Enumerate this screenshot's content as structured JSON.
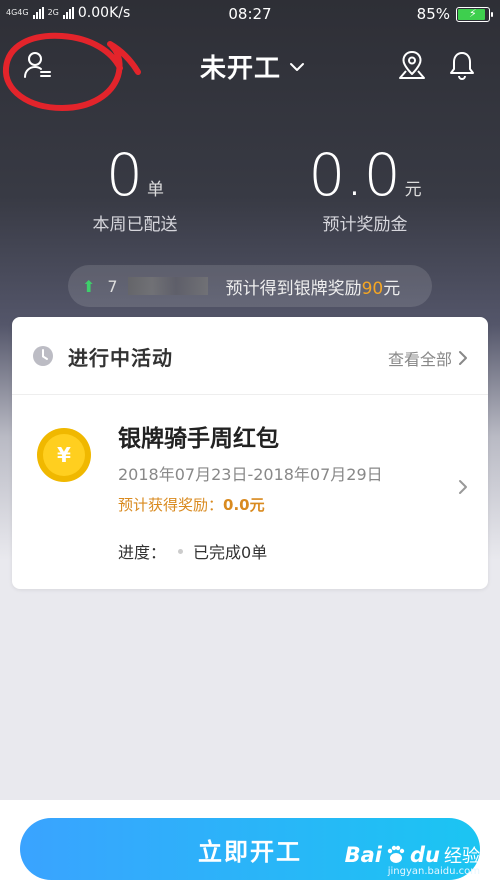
{
  "status": {
    "network_labels": [
      "4G",
      "4G",
      "2G"
    ],
    "speed": "0.00K/s",
    "time": "08:27",
    "battery": "85%",
    "battery_level": 0.85
  },
  "header": {
    "title": "未开工",
    "icons": [
      "user-menu-icon",
      "location-icon",
      "bell-icon"
    ]
  },
  "stats": {
    "deliveries": {
      "value": "0",
      "unit": "单",
      "label": "本周已配送"
    },
    "reward": {
      "value": "0.0",
      "unit": "元",
      "label": "预计奖励金"
    }
  },
  "banner": {
    "rank_glyph": "7",
    "text": "预计得到银牌奖励",
    "amount": "90",
    "unit": "元"
  },
  "activities": {
    "title": "进行中活动",
    "see_all": "查看全部",
    "item": {
      "name": "银牌骑手周红包",
      "date": "2018年07月23日-2018年07月29日",
      "reward_label": "预计获得奖励：",
      "reward_value": "0.0元",
      "progress_label": "进度：",
      "progress_value": "已完成0单",
      "coin_symbol": "¥"
    }
  },
  "action": {
    "start_label": "立即开工"
  },
  "watermark": {
    "brand": "Bai",
    "brand2": "du",
    "cn": "经验",
    "site": "jingyan.baidu.com"
  },
  "colors": {
    "accent_orange": "#f5a623",
    "reward_orange": "#d98a1f",
    "button_start": "#3aa3ff",
    "button_end": "#1bc5f2",
    "annotation_red": "#e3242b"
  }
}
